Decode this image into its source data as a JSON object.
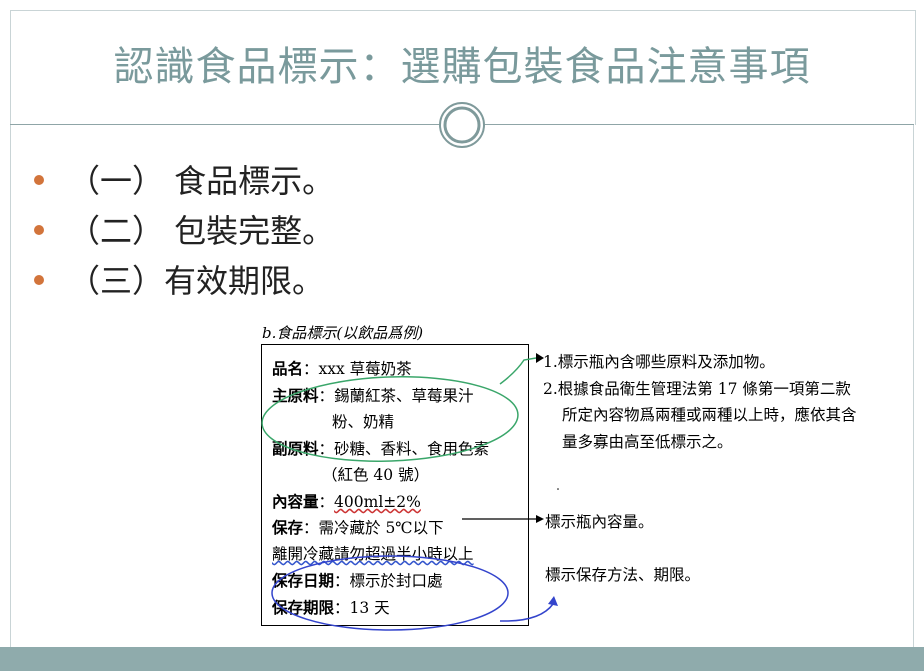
{
  "slide": {
    "title": "認識食品標示：選購包裝食品注意事項",
    "bullets": [
      {
        "text": "（一） 食品標示。"
      },
      {
        "text": "（二） 包裝完整。"
      },
      {
        "text": "（三）有效期限。"
      }
    ]
  },
  "figure": {
    "caption": "b.食品標示(以飲品爲例)",
    "label": {
      "name_key": "品名",
      "name_value": "：xxx 草莓奶茶",
      "main_key": "主原料",
      "main_value_1": "：錫蘭紅茶、草莓果汁",
      "main_value_2": "粉、奶精",
      "sub_key": "副原料",
      "sub_value_1": "：砂糖、香料、食用色素",
      "sub_value_2": "（紅色 40 號）",
      "volume_key": "內容量",
      "volume_sep": "：",
      "volume_value": "400ml±2%",
      "storage_key": "保存",
      "storage_value": "：需冷藏於 5℃以下",
      "storage_line_2": "離開冷藏請勿超過半小時以上",
      "date_key": "保存日期",
      "date_value": "：標示於封口處",
      "period_key": "保存期限",
      "period_value": "：13 天"
    },
    "notes": {
      "note1": "1.標示瓶內含哪些原料及添加物。",
      "note2_line1": "2.根據食品衛生管理法第 17 條第一項第二款",
      "note2_line2": "所定內容物爲兩種或兩種以上時，應依其含",
      "note2_line3": "量多寡由高至低標示之。",
      "note3": "標示瓶內容量。",
      "note4": "標示保存方法、期限。"
    }
  },
  "colors": {
    "title": "#7a9a9c",
    "bullet": "#d2743b",
    "bottom_bar": "#8fabac",
    "green_ellipse": "#3aa66a",
    "blue_ellipse": "#3344cc"
  }
}
